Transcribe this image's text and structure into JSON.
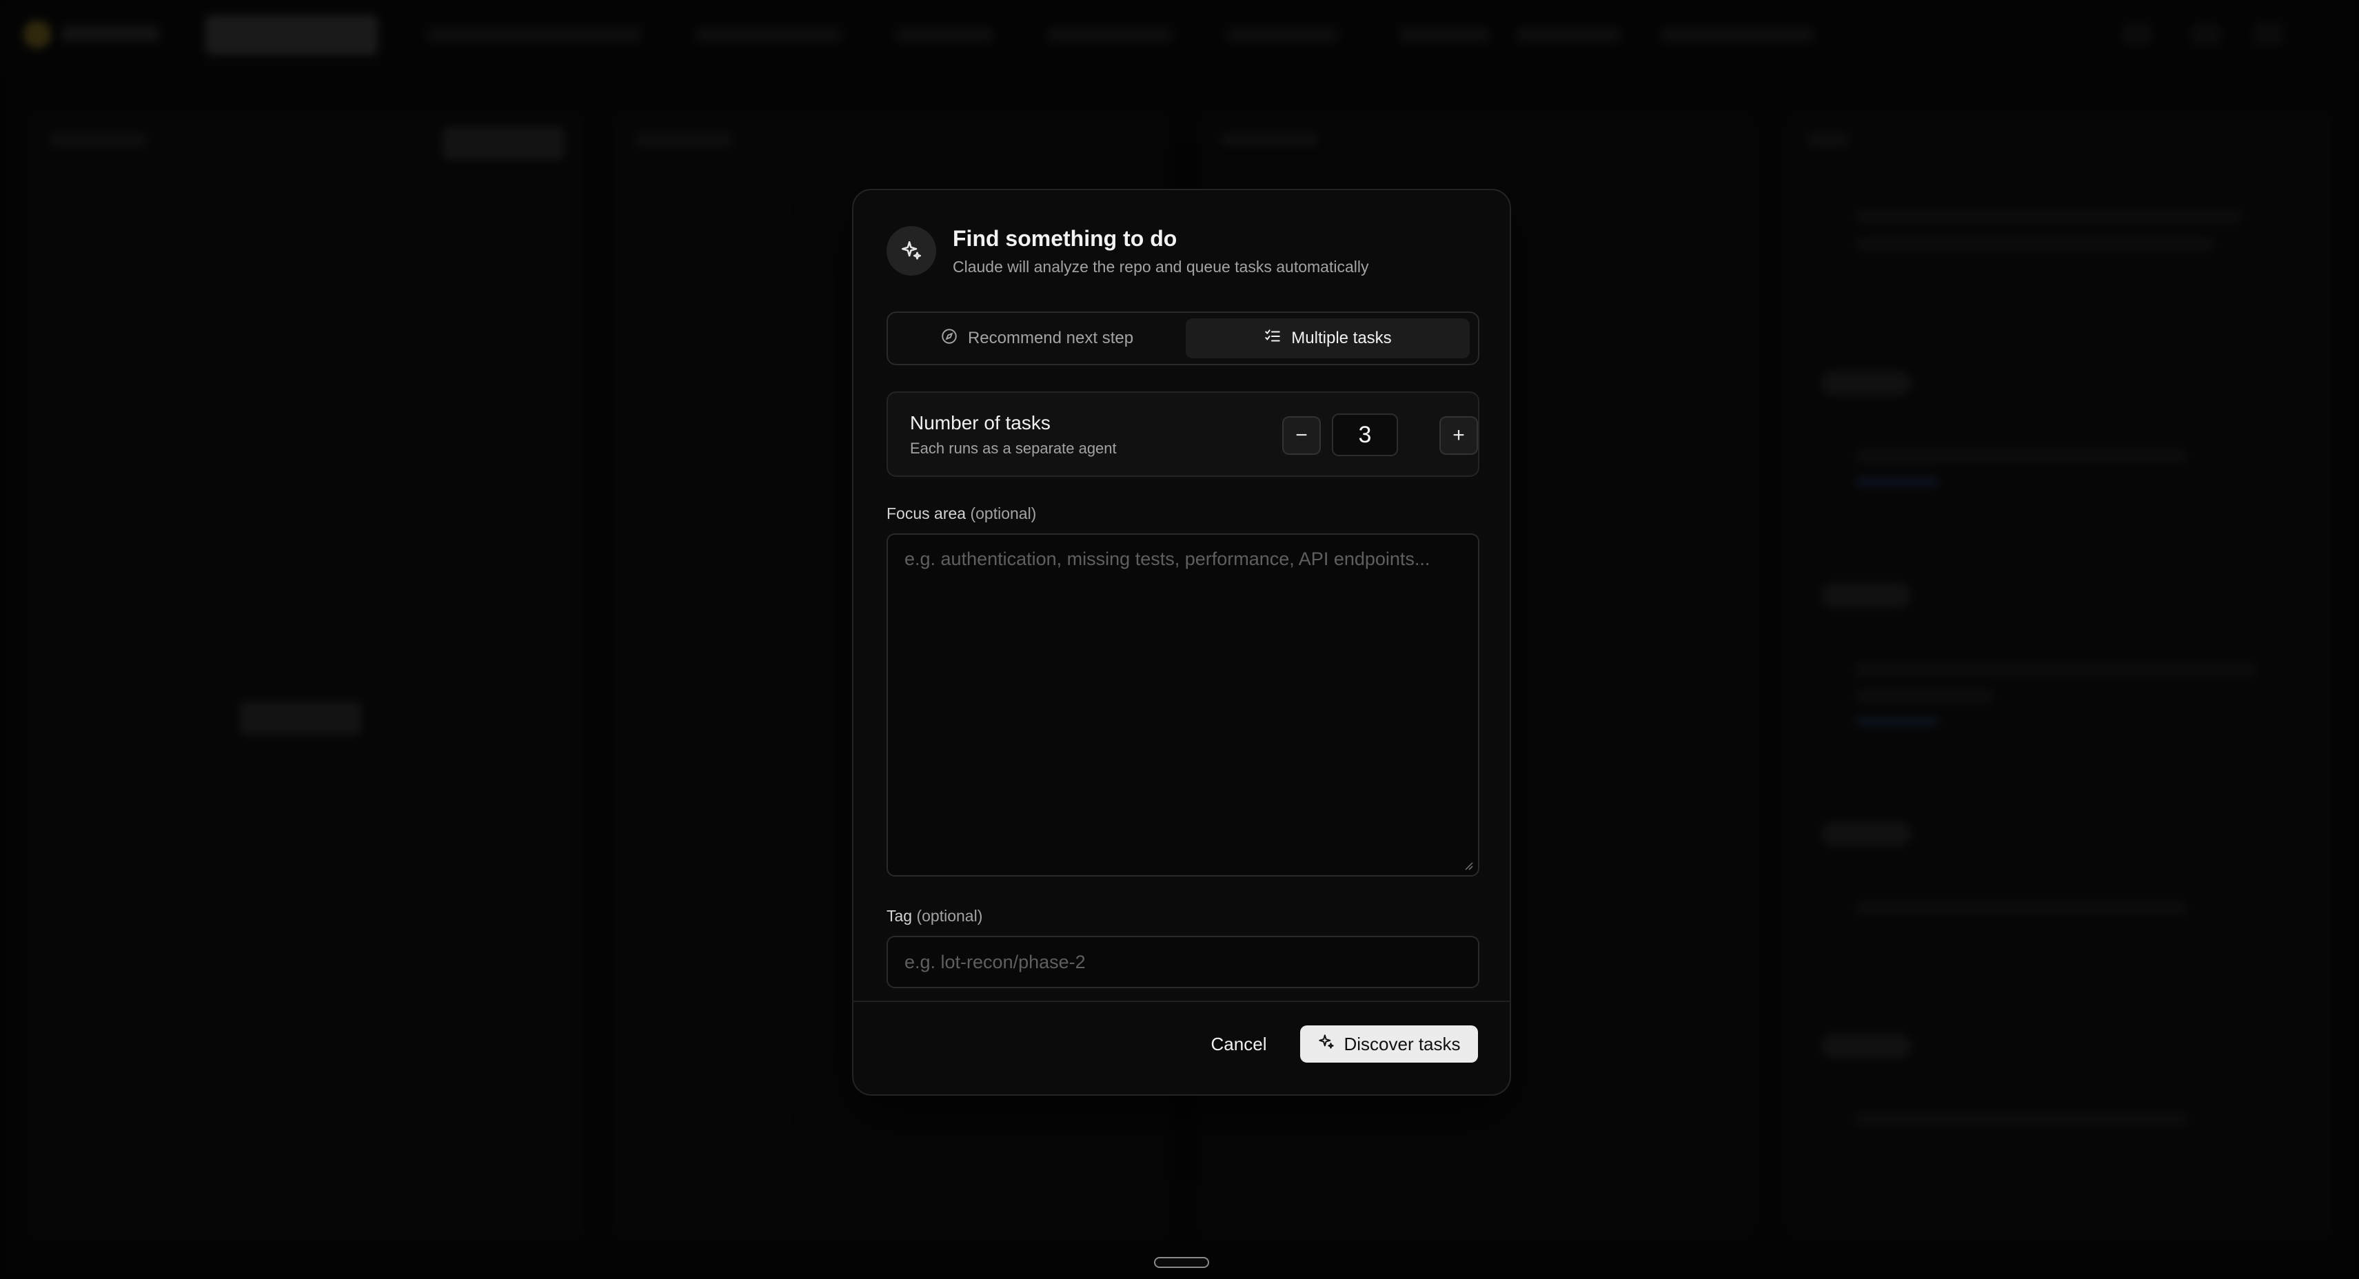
{
  "modal": {
    "title": "Find something to do",
    "subtitle": "Claude will analyze the repo and queue tasks automatically",
    "header_icon": "sparkles-icon",
    "mode_toggle": {
      "options": [
        {
          "label": "Recommend next step",
          "icon": "compass-icon",
          "selected": false
        },
        {
          "label": "Multiple tasks",
          "icon": "checklist-icon",
          "selected": true
        }
      ]
    },
    "task_count": {
      "title": "Number of tasks",
      "subtitle": "Each runs as a separate agent",
      "value": "3",
      "decrement_label": "−",
      "increment_label": "+"
    },
    "focus_area": {
      "label": "Focus area",
      "optional_hint": "(optional)",
      "placeholder": "e.g. authentication, missing tests, performance, API endpoints...",
      "value": ""
    },
    "tag": {
      "label": "Tag",
      "optional_hint": "(optional)",
      "placeholder": "e.g. lot-recon/phase-2",
      "value": ""
    },
    "footer": {
      "cancel_label": "Cancel",
      "discover_label": "Discover tasks",
      "discover_icon": "sparkles-icon"
    }
  },
  "colors": {
    "modal_bg": "#0b0b0b",
    "primary_button_bg": "#ececec",
    "muted_text": "#a3a3a3",
    "placeholder_text": "#5f5f5f"
  }
}
